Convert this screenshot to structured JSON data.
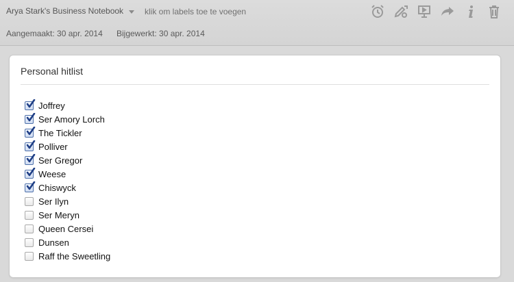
{
  "header": {
    "notebook_name": "Arya Stark's Business Notebook",
    "tags_placeholder": "klik om labels toe te voegen",
    "created": "Aangemaakt: 30 apr. 2014",
    "updated": "Bijgewerkt: 30 apr. 2014",
    "toolbar": [
      "alarm-clock-icon",
      "annotate-icon",
      "presentation-icon",
      "share-icon",
      "info-icon",
      "trash-icon"
    ]
  },
  "note": {
    "title": "Personal hitlist",
    "items": [
      {
        "label": "Joffrey",
        "checked": true
      },
      {
        "label": "Ser Amory Lorch",
        "checked": true
      },
      {
        "label": "The Tickler",
        "checked": true
      },
      {
        "label": "Polliver",
        "checked": true
      },
      {
        "label": "Ser Gregor",
        "checked": true
      },
      {
        "label": "Weese",
        "checked": true
      },
      {
        "label": "Chiswyck",
        "checked": true
      },
      {
        "label": "Ser Ilyn",
        "checked": false
      },
      {
        "label": "Ser Meryn",
        "checked": false
      },
      {
        "label": "Queen Cersei",
        "checked": false
      },
      {
        "label": "Dunsen",
        "checked": false
      },
      {
        "label": "Raff the Sweetling",
        "checked": false
      }
    ]
  },
  "colors": {
    "checkmark": "#1f3f86",
    "icon": "#9a9a9a"
  }
}
